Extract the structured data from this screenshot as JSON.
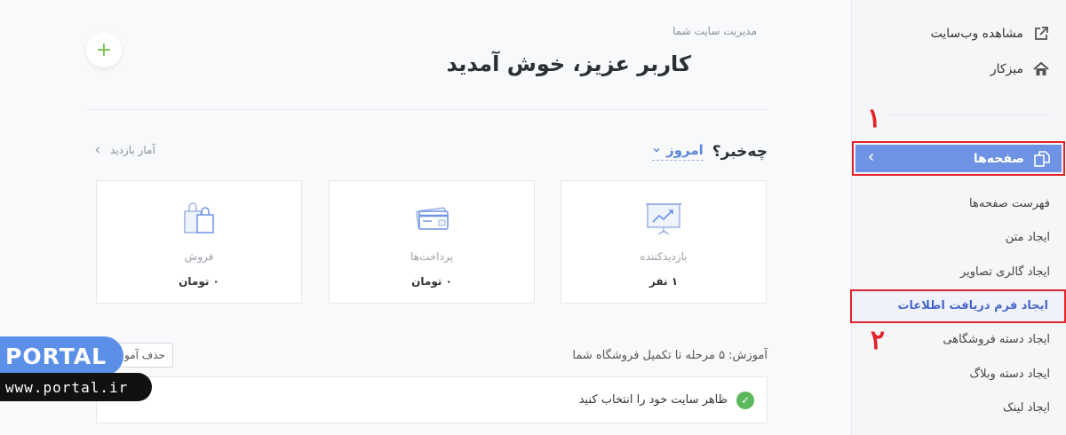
{
  "sidebar": {
    "view_site": "مشاهده وب‌سایت",
    "dashboard": "میزکار",
    "pages": "صفحه‌ها",
    "items": [
      {
        "label": "فهرست صفحه‌ها"
      },
      {
        "label": "ایجاد متن"
      },
      {
        "label": "ایجاد گالری تصاویر"
      },
      {
        "label": "ایجاد فرم دریافت اطلاعات",
        "active": true
      },
      {
        "label": "ایجاد دسته فروشگاهی"
      },
      {
        "label": "ایجاد دسته وبلاگ"
      },
      {
        "label": "ایجاد لینک"
      }
    ],
    "marker_1": "۱",
    "marker_2": "۲"
  },
  "header": {
    "subtitle": "مدیریت سایت شما",
    "welcome": "کاربر عزیز، خوش آمدید",
    "add_icon": "+"
  },
  "whats_new": {
    "title": "چه‌خبر؟",
    "period": "امروز",
    "visit_stats": "آمار بازدید"
  },
  "cards": [
    {
      "label": "بازدیدکننده",
      "value": "۱ نفر",
      "icon": "presentation-chart-icon"
    },
    {
      "label": "پرداخت‌ها",
      "value": "۰ تومان",
      "icon": "credit-card-icon"
    },
    {
      "label": "فروش",
      "value": "۰ تومان",
      "icon": "shopping-bags-icon"
    }
  ],
  "tutorial": {
    "title": "آموزش: ۵ مرحله تا تکمیل فروشگاه شما",
    "delete_label": "حذف آمو",
    "task_label": "ظاهر سایت خود را انتخاب کنید"
  },
  "watermark": {
    "brand": "PORTAL",
    "url": "www.portal.ir"
  },
  "colors": {
    "accent": "#6e93e4",
    "highlight": "#e1222a",
    "success": "#5cb85c",
    "plus": "#7cc14f"
  }
}
